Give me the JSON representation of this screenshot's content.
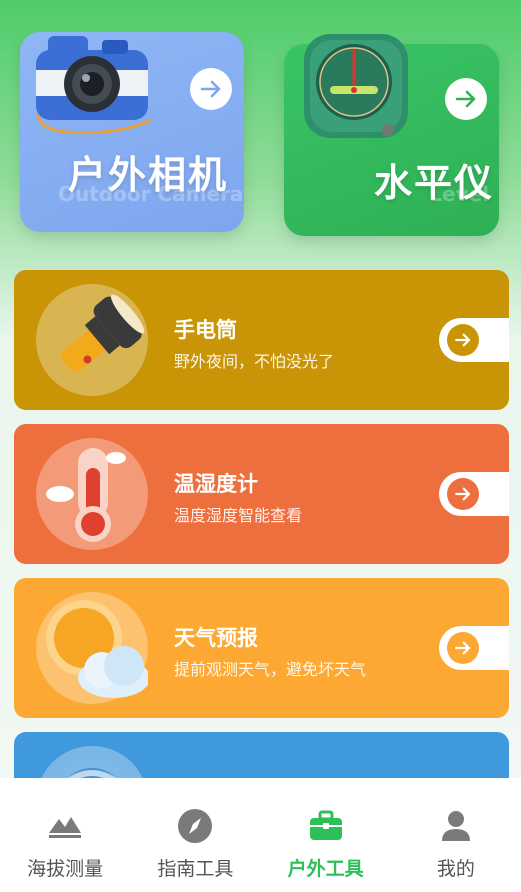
{
  "top_cards": [
    {
      "title": "户外相机",
      "subtitle": "Outdoor Camera",
      "color": "#7ea6ee",
      "icon": "camera-icon"
    },
    {
      "title": "水平仪",
      "subtitle": "Level",
      "color": "#2eb055",
      "icon": "level-icon"
    }
  ],
  "tools": [
    {
      "title": "手电筒",
      "desc": "野外夜间，不怕没光了",
      "color": "#c99507",
      "icon": "flashlight-icon"
    },
    {
      "title": "温湿度计",
      "desc": "温度湿度智能查看",
      "color": "#ee6f3e",
      "icon": "thermometer-icon"
    },
    {
      "title": "天气预报",
      "desc": "提前观测天气，避免坏天气",
      "color": "#fda833",
      "icon": "weather-icon"
    },
    {
      "title": "",
      "desc": "",
      "color": "#4199dd",
      "icon": "compass-icon"
    }
  ],
  "tabbar": {
    "items": [
      {
        "label": "海拔测量",
        "icon": "mountain-icon"
      },
      {
        "label": "指南工具",
        "icon": "compass-icon"
      },
      {
        "label": "户外工具",
        "icon": "toolbox-icon",
        "active": true
      },
      {
        "label": "我的",
        "icon": "person-icon"
      }
    ],
    "active_color": "#2fbf59"
  }
}
